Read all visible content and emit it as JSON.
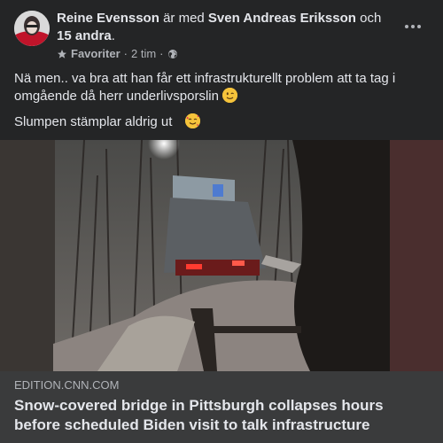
{
  "post": {
    "author": "Reine Evensson",
    "with_text": "är med",
    "tagged": "Sven Andreas Eriksson",
    "and_text": "och",
    "others": "15 andra",
    "period": ".",
    "favorites_label": "Favoriter",
    "separator": "·",
    "time": "2 tim",
    "separator2": "·",
    "text_line1": "Nä men.. va bra att han får ett infrastrukturellt problem att ta tag i omgående då herr underlivsporslin",
    "text_line2": "Slumpen stämplar aldrig ut"
  },
  "link_preview": {
    "domain": "EDITION.CNN.COM",
    "title": "Snow-covered bridge in Pittsburgh collapses hours before scheduled Biden visit to talk infrastructure"
  },
  "icons": {
    "favorites": "star-icon",
    "audience": "globe-icon",
    "more": "more-horizontal-icon",
    "emoji1": "winking-face-emoji",
    "emoji2": "smiling-face-with-hearts-emoji"
  },
  "colors": {
    "background": "#242526",
    "link_bar": "#3a3b3c",
    "primary_text": "#e4e6eb",
    "secondary_text": "#b0b3b8"
  }
}
